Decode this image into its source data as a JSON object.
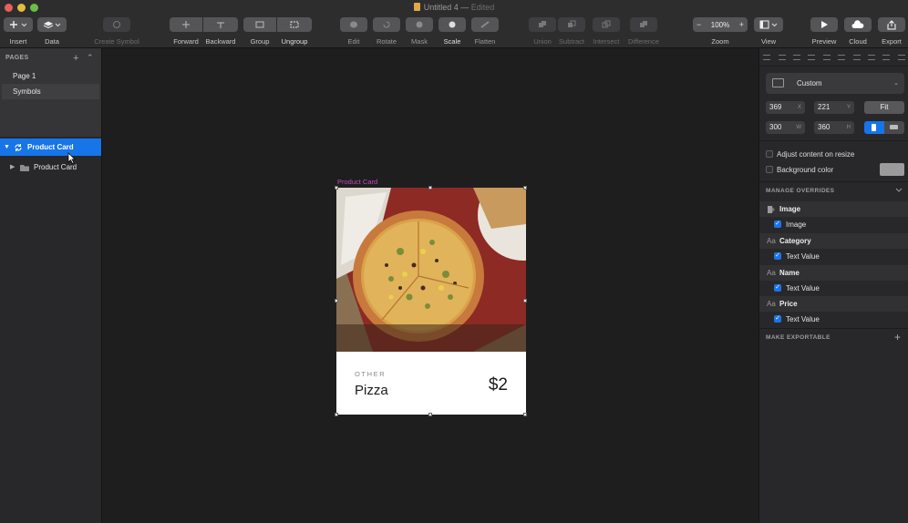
{
  "window": {
    "title": "Untitled 4",
    "status": "Edited"
  },
  "toolbar": {
    "insert": "Insert",
    "data": "Data",
    "create_symbol": "Create Symbol",
    "forward": "Forward",
    "backward": "Backward",
    "group": "Group",
    "ungroup": "Ungroup",
    "edit": "Edit",
    "rotate": "Rotate",
    "mask": "Mask",
    "scale": "Scale",
    "flatten": "Flatten",
    "union": "Union",
    "subtract": "Subtract",
    "intersect": "Intersect",
    "difference": "Difference",
    "zoom_label": "Zoom",
    "zoom_value": "100%",
    "zoom_minus": "−",
    "zoom_plus": "+",
    "view": "View",
    "preview": "Preview",
    "cloud": "Cloud",
    "export": "Export"
  },
  "pages": {
    "header": "PAGES",
    "add": "+",
    "collapse": "⌃",
    "items": [
      {
        "label": "Page 1"
      },
      {
        "label": "Symbols"
      }
    ],
    "selected": "Symbols"
  },
  "layers": [
    {
      "label": "Product Card",
      "selected": true,
      "icon": "symbol-icon"
    },
    {
      "label": "Product Card",
      "selected": false,
      "icon": "folder-icon"
    }
  ],
  "canvas": {
    "artboard_label": "Product Card",
    "card": {
      "category": "OTHER",
      "name": "Pizza",
      "price": "$2"
    }
  },
  "inspector": {
    "preset": "Custom",
    "x": "369",
    "x_unit": "X",
    "y": "221",
    "y_unit": "Y",
    "w": "300",
    "w_unit": "W",
    "h": "360",
    "h_unit": "H",
    "fit": "Fit",
    "adjust_content": "Adjust content on resize",
    "background_color": "Background color",
    "background_swatch": "#9b9b9b",
    "manage_overrides": "MANAGE OVERRIDES",
    "overrides": [
      {
        "title": "Image",
        "icon": "image-override-icon",
        "item": "Image"
      },
      {
        "title": "Category",
        "icon": "text-override-icon",
        "item": "Text Value"
      },
      {
        "title": "Name",
        "icon": "text-override-icon",
        "item": "Text Value"
      },
      {
        "title": "Price",
        "icon": "text-override-icon",
        "item": "Text Value"
      }
    ],
    "text_icon_glyph": "Aa",
    "make_exportable": "MAKE EXPORTABLE",
    "export_add": "+"
  },
  "colors": {
    "accent": "#1675e8",
    "artboard_label": "#c249b6"
  }
}
